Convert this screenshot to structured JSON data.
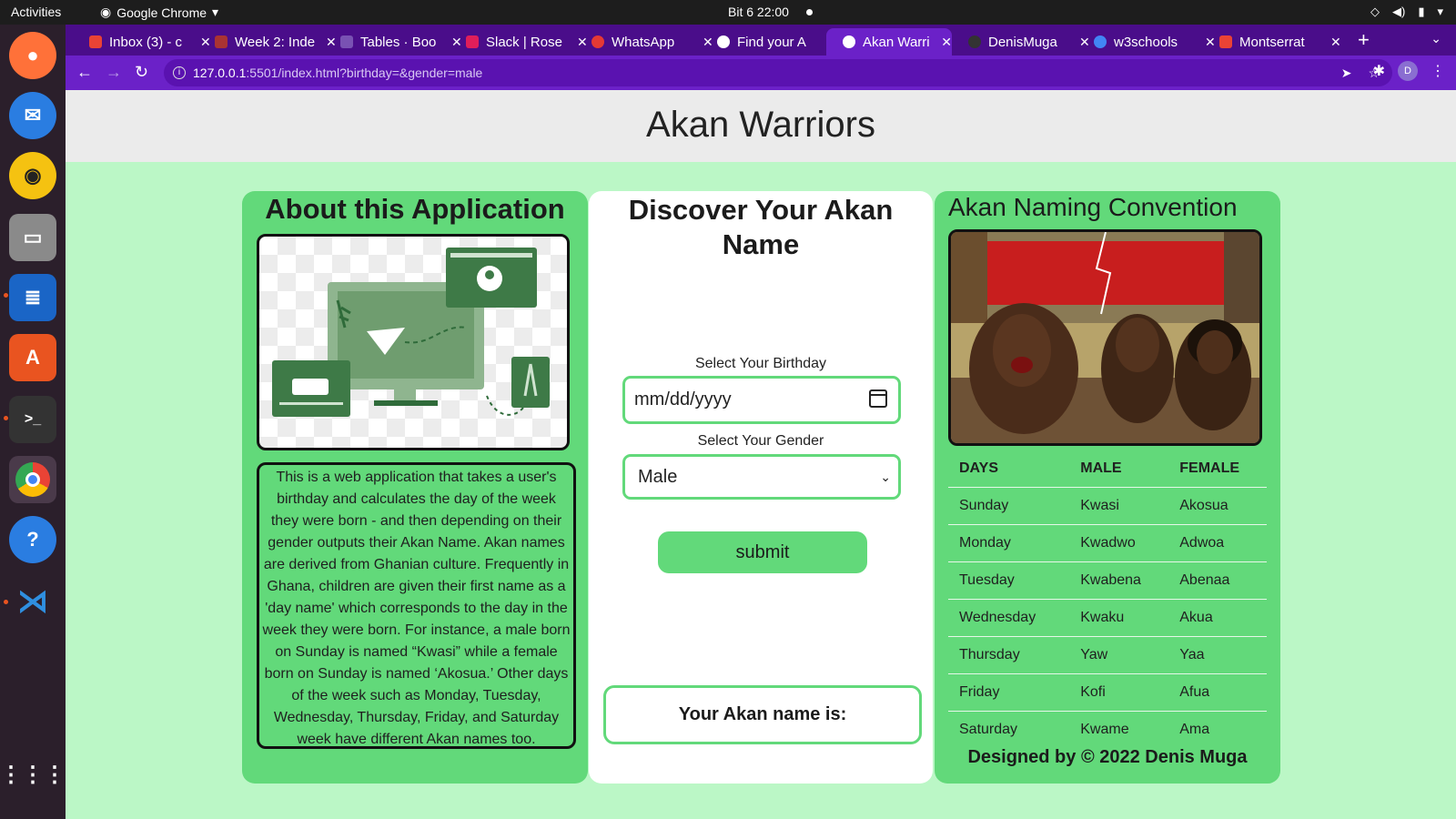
{
  "system": {
    "activities": "Activities",
    "app_name": "Google Chrome",
    "clock": "Bit 6  22:00"
  },
  "browser": {
    "tabs": [
      {
        "label": "Inbox (3) - c",
        "color": "#ea4335"
      },
      {
        "label": "Week 2: Inde",
        "color": "#a33"
      },
      {
        "label": "Tables · Boo",
        "color": "#7952b3"
      },
      {
        "label": "Slack | Rose",
        "color": "#e01e5a"
      },
      {
        "label": "WhatsApp",
        "color": "#e53935"
      },
      {
        "label": "Find your A",
        "color": "#ffffff"
      },
      {
        "label": "Akan Warri",
        "color": "#ffffff"
      },
      {
        "label": "DenisMuga",
        "color": "#333333"
      },
      {
        "label": "w3schools",
        "color": "#4285f4"
      },
      {
        "label": "Montserrat",
        "color": "#ea4335"
      }
    ],
    "url_host": "127.0.0.1",
    "url_path": ":5501/index.html?birthday=&gender=male",
    "profile_initial": "D"
  },
  "page": {
    "title": "Akan Warriors",
    "about": {
      "heading": "About this Application",
      "text": "This is a web application that takes a user's birthday and calculates the day of the week they were born - and then depending on their gender outputs their Akan Name. Akan names are derived from Ghanian culture. Frequently in Ghana, children are given their first name as a 'day name' which corresponds to the day in the week they were born. For instance, a male born on Sunday is named “Kwasi” while a female born on Sunday is named ‘Akosua.’ Other days of the week such as Monday, Tuesday, Wednesday, Thursday, Friday, and Saturday week have different Akan names too."
    },
    "form": {
      "heading": "Discover Your Akan Name",
      "birthday_label": "Select Your Birthday",
      "birthday_placeholder": "mm/dd/yyyy",
      "gender_label": "Select Your Gender",
      "gender_value": "Male",
      "submit_label": "submit",
      "result_label": "Your Akan name is:"
    },
    "convention": {
      "heading": "Akan Naming Convention",
      "headers": [
        "DAYS",
        "MALE",
        "FEMALE"
      ],
      "rows": [
        [
          "Sunday",
          "Kwasi",
          "Akosua"
        ],
        [
          "Monday",
          "Kwadwo",
          "Adwoa"
        ],
        [
          "Tuesday",
          "Kwabena",
          "Abenaa"
        ],
        [
          "Wednesday",
          "Kwaku",
          "Akua"
        ],
        [
          "Thursday",
          "Yaw",
          "Yaa"
        ],
        [
          "Friday",
          "Kofi",
          "Afua"
        ],
        [
          "Saturday",
          "Kwame",
          "Ama"
        ]
      ],
      "footer": "Designed by © 2022 Denis Muga"
    }
  },
  "colors": {
    "accent_green": "#62d97a",
    "page_bg": "#bbf7c6",
    "chrome_purple": "#6b21c8"
  }
}
